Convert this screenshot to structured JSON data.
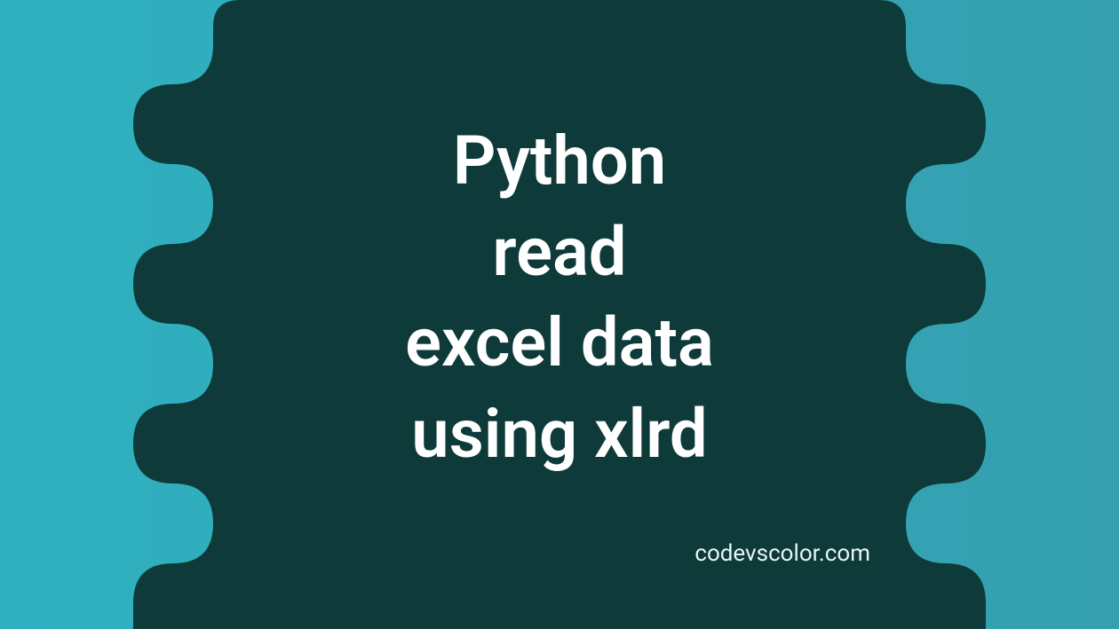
{
  "title_lines": "Python\nread\nexcel data\nusing xlrd",
  "attribution": "codevscolor.com",
  "colors": {
    "bg_gradient_start": "#2fb1c0",
    "bg_gradient_end": "#359faf",
    "blob_fill": "#0e3a3a",
    "text_primary": "#ffffff",
    "text_secondary": "#e8f4f5"
  }
}
